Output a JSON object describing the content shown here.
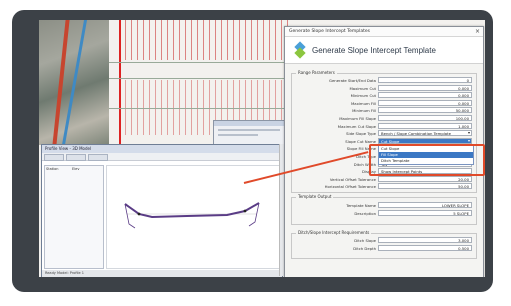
{
  "dialog": {
    "window_title": "Generate Slope Intercept Templates",
    "heading": "Generate Slope Intercept Template",
    "close_glyph": "×",
    "section_range": "Range Parameters",
    "rows": [
      {
        "label": "Generate Start/End Data",
        "value": "0"
      },
      {
        "label": "Maximum Cut",
        "value": "0.000"
      },
      {
        "label": "Minimum Cut",
        "value": "0.000"
      },
      {
        "label": "Maximum Fill",
        "value": "0.000"
      },
      {
        "label": "Minimum Fill",
        "value": "50.000"
      },
      {
        "label": "Maximum Fill Slope",
        "value": "100.00"
      },
      {
        "label": "Maximum Cut Slope",
        "value": "1.000"
      },
      {
        "label": "Side Slope Type",
        "value": "Bench / Slope Combination Template"
      },
      {
        "label": "Slope Cut Name",
        "value": "Cut Slope"
      },
      {
        "label": "Slope Fill Name",
        "value": "Fill Slope"
      },
      {
        "label": "Ditch Type",
        "value": "Ditch Template"
      },
      {
        "label": "Ditch Width",
        "value": "Yes"
      },
      {
        "label": "Display",
        "value": "Show Intercept Points"
      },
      {
        "label": "Vertical Offset Tolerance",
        "value": "20.00"
      },
      {
        "label": "Horizontal Offset Tolerance",
        "value": "50.00"
      }
    ],
    "dropdown_options": [
      "Cut Slope",
      "Fill Slope",
      "Ditch Template"
    ],
    "section_output": "Template Output",
    "output_rows": [
      {
        "label": "Template Name",
        "value": "LOWER SLOPE"
      },
      {
        "label": "Description",
        "value": "5 SLOPE"
      }
    ],
    "section_ditch": "Ditch/Slope Intercept Requirements",
    "ditch_rows": [
      {
        "label": "Ditch Slope",
        "value": "3.000"
      },
      {
        "label": "Ditch Depth",
        "value": "0.500"
      }
    ]
  },
  "profile_window": {
    "title": "Profile View - 3D Model",
    "col_a": "Station",
    "col_b": "Elev",
    "status": "Ready   Model: Profile 1"
  },
  "colors": {
    "frame": "#3c4147",
    "highlight": "#e04a2a",
    "selection": "#3b78c4"
  }
}
